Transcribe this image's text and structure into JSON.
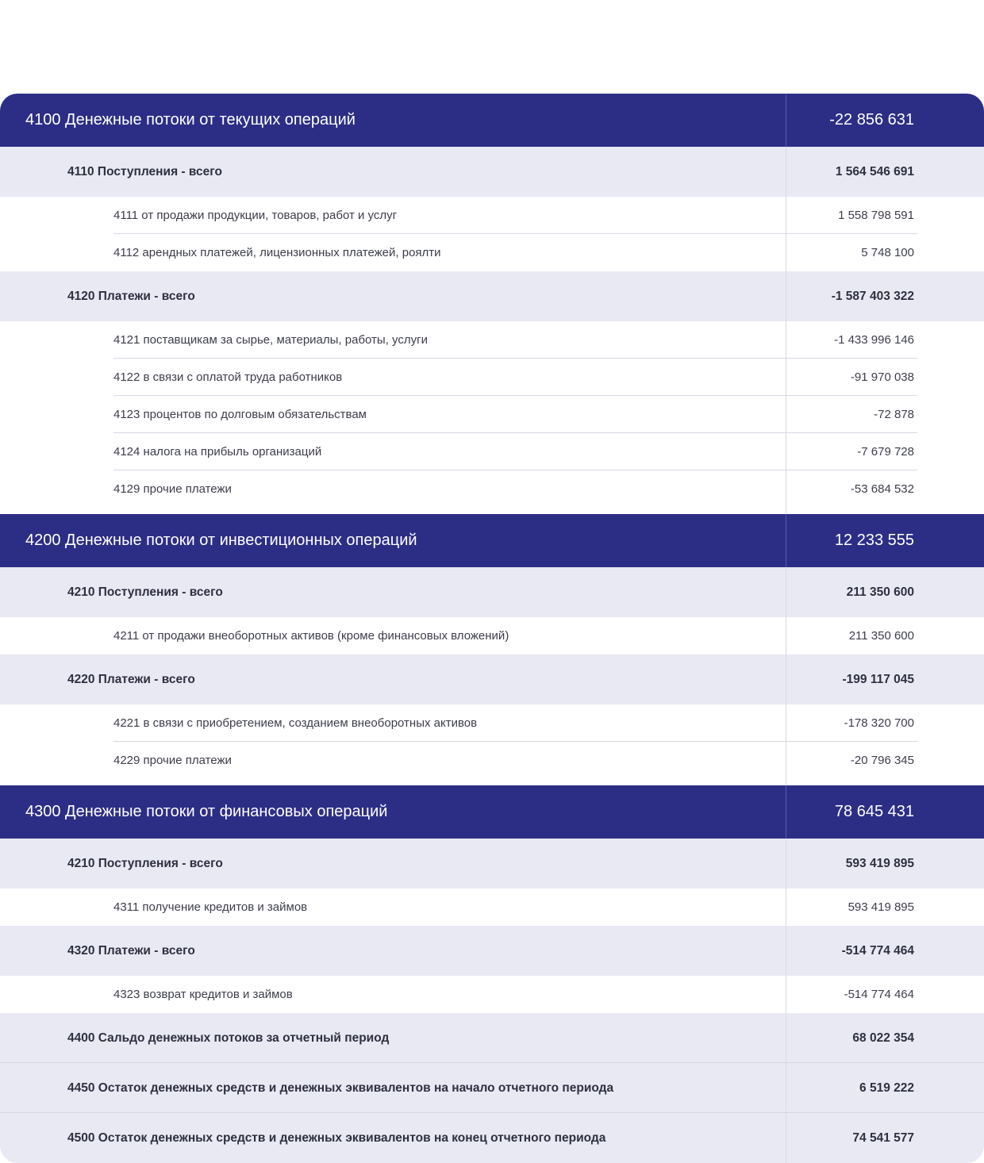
{
  "rows": [
    {
      "type": "section",
      "label": "4100 Денежные потоки от текущих операций",
      "value": "-22 856 631"
    },
    {
      "type": "sub",
      "label": "4110 Поступления - всего",
      "value": "1 564 546 691"
    },
    {
      "type": "item",
      "label": "4111 от продажи продукции, товаров, работ и услуг",
      "value": "1 558 798 591"
    },
    {
      "type": "item",
      "label": "4112 арендных платежей, лицензионных платежей, роялти",
      "value": "5 748 100"
    },
    {
      "type": "sub",
      "label": "4120 Платежи - всего",
      "value": "-1 587 403 322"
    },
    {
      "type": "item",
      "label": "4121 поставщикам за сырье, материалы, работы, услуги",
      "value": "-1 433 996 146"
    },
    {
      "type": "item",
      "label": "4122 в связи с оплатой труда работников",
      "value": "-91 970 038"
    },
    {
      "type": "item",
      "label": "4123 процентов по долговым обязательствам",
      "value": "-72 878"
    },
    {
      "type": "item",
      "label": "4124 налога на прибыль организаций",
      "value": "-7 679 728"
    },
    {
      "type": "item",
      "label": "4129 прочие платежи",
      "value": "-53 684 532"
    },
    {
      "type": "section",
      "label": "4200 Денежные потоки от инвестиционных операций",
      "value": "12 233 555"
    },
    {
      "type": "sub",
      "label": "4210 Поступления - всего",
      "value": "211 350 600"
    },
    {
      "type": "item",
      "label": "4211 от продажи внеоборотных активов (кроме финансовых вложений)",
      "value": "211 350 600"
    },
    {
      "type": "sub",
      "label": "4220 Платежи - всего",
      "value": "-199 117 045"
    },
    {
      "type": "item",
      "label": "4221 в связи с приобретением, созданием внеоборотных активов",
      "value": "-178 320 700"
    },
    {
      "type": "item",
      "label": "4229 прочие платежи",
      "value": "-20 796 345"
    },
    {
      "type": "section",
      "label": "4300 Денежные потоки от финансовых операций",
      "value": "78 645 431"
    },
    {
      "type": "sub",
      "label": "4210 Поступления - всего",
      "value": "593 419 895"
    },
    {
      "type": "item",
      "label": "4311 получение кредитов и займов",
      "value": "593 419 895"
    },
    {
      "type": "sub",
      "label": "4320 Платежи - всего",
      "value": "-514 774 464"
    },
    {
      "type": "item",
      "label": "4323 возврат кредитов и займов",
      "value": "-514 774 464"
    },
    {
      "type": "total",
      "label": "4400 Сальдо денежных потоков за отчетный период",
      "value": "68 022 354"
    },
    {
      "type": "total",
      "label": "4450 Остаток денежных средств  и денежных эквивалентов на начало отчетного периода",
      "value": "6 519 222"
    },
    {
      "type": "total",
      "label": "4500 Остаток денежных средств и денежных эквивалентов на конец отчетного периода",
      "value": "74 541 577"
    }
  ]
}
